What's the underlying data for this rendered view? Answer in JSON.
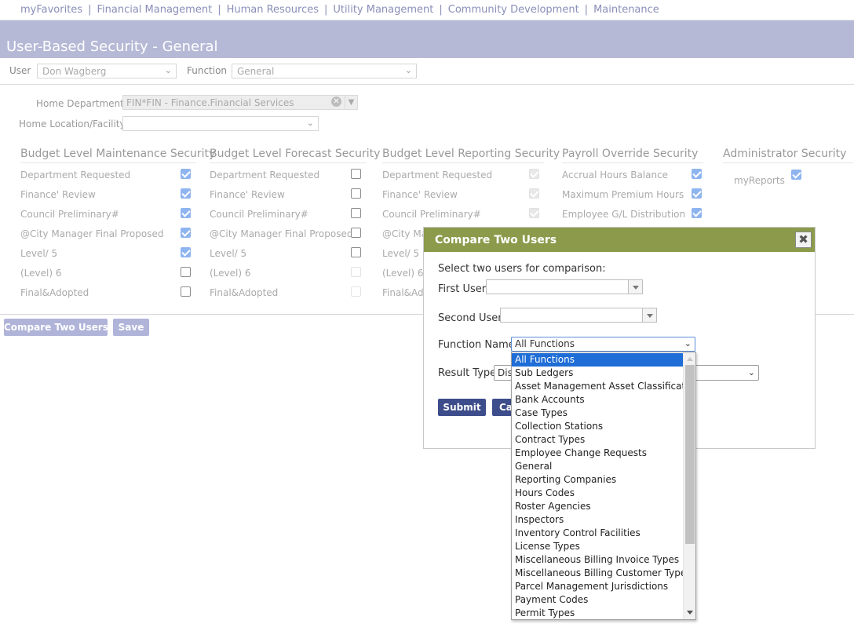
{
  "nav": {
    "items": [
      "myFavorites",
      "Financial Management",
      "Human Resources",
      "Utility Management",
      "Community Development",
      "Maintenance"
    ],
    "separator": "|"
  },
  "page": {
    "title": "User-Based Security - General"
  },
  "user_bar": {
    "user_label": "User",
    "user_value": "Don Wagberg",
    "function_label": "Function",
    "function_value": "General"
  },
  "home": {
    "dept_label": "Home Department",
    "dept_value": "FIN*FIN - Finance.Financial Services",
    "location_label": "Home Location/Facility",
    "location_value": ""
  },
  "sections": [
    {
      "title": "Budget Level Maintenance Security",
      "rows": [
        {
          "label": "Department Requested",
          "state": "on"
        },
        {
          "label": "Finance' Review",
          "state": "on"
        },
        {
          "label": "Council Preliminary#",
          "state": "on"
        },
        {
          "label": "@City Manager Final Proposed",
          "state": "on"
        },
        {
          "label": "Level/ 5",
          "state": "on"
        },
        {
          "label": "(Level) 6",
          "state": "off"
        },
        {
          "label": "Final&Adopted",
          "state": "off"
        }
      ]
    },
    {
      "title": "Budget Level Forecast Security",
      "rows": [
        {
          "label": "Department Requested",
          "state": "off"
        },
        {
          "label": "Finance' Review",
          "state": "off"
        },
        {
          "label": "Council Preliminary#",
          "state": "off"
        },
        {
          "label": "@City Manager Final Proposed",
          "state": "off"
        },
        {
          "label": "Level/ 5",
          "state": "off"
        },
        {
          "label": "(Level) 6",
          "state": "disabled"
        },
        {
          "label": "Final&Adopted",
          "state": "disabled"
        }
      ]
    },
    {
      "title": "Budget Level Reporting Security",
      "rows": [
        {
          "label": "Department Requested",
          "state": "disabled-on"
        },
        {
          "label": "Finance' Review",
          "state": "disabled-on"
        },
        {
          "label": "Council Preliminary#",
          "state": "disabled-on"
        },
        {
          "label": "@City Ma",
          "state": "hidden"
        },
        {
          "label": "Level/ 5",
          "state": "hidden"
        },
        {
          "label": "(Level) 6",
          "state": "hidden"
        },
        {
          "label": "Final&Ado",
          "state": "hidden"
        }
      ]
    },
    {
      "title": "Payroll Override Security",
      "rows": [
        {
          "label": "Accrual Hours Balance",
          "state": "on"
        },
        {
          "label": "Maximum Premium Hours",
          "state": "on"
        },
        {
          "label": "Employee G/L Distribution",
          "state": "on"
        }
      ]
    },
    {
      "title": "Administrator Security",
      "rows": [
        {
          "label": "myReports",
          "state": "on"
        }
      ]
    }
  ],
  "buttons": {
    "compare": "Compare Two Users",
    "save": "Save"
  },
  "modal": {
    "title": "Compare Two Users",
    "close": "✖",
    "prompt": "Select two users for comparison:",
    "first_user_label": "First User",
    "second_user_label": "Second User",
    "function_label": "Function Name",
    "function_value": "All Functions",
    "result_label": "Result Type",
    "result_value": "Dis",
    "submit": "Submit",
    "cancel": "Ca",
    "header_color": "#8b9a4b"
  },
  "function_options": [
    "All Functions",
    "Sub Ledgers",
    "Asset Management Asset Classifications",
    "Bank Accounts",
    "Case Types",
    "Collection Stations",
    "Contract Types",
    "Employee Change Requests",
    "General",
    "Reporting Companies",
    "Hours Codes",
    "Roster Agencies",
    "Inspectors",
    "Inventory Control Facilities",
    "License Types",
    "Miscellaneous Billing Invoice Types",
    "Miscellaneous Billing Customer Types",
    "Parcel Management Jurisdictions",
    "Payment Codes",
    "Permit Types"
  ],
  "selected_function_index": 0,
  "colors": {
    "banner": "#b6b9d6",
    "button": "#b0b4d9",
    "checkbox_on": "#8fb5f0",
    "selected_option": "#1f6dd6",
    "modal_button": "#3d4c8a"
  }
}
